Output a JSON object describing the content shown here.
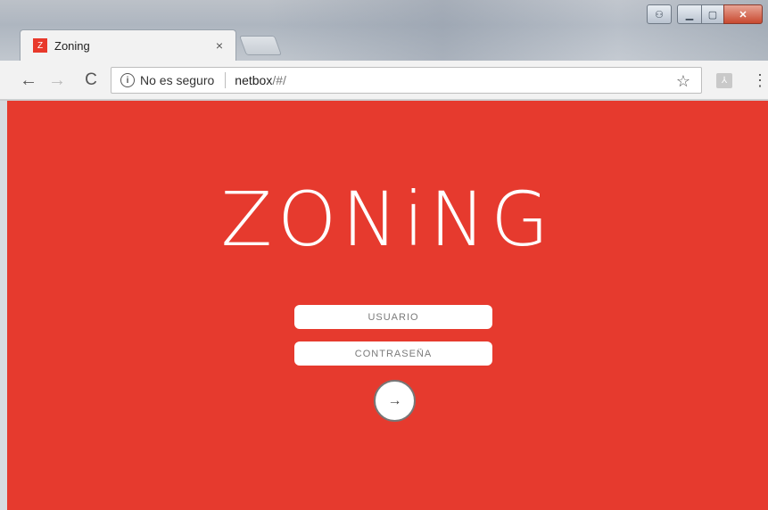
{
  "window": {
    "controls": {
      "user": "⚇",
      "minimize": "▁",
      "maximize": "▢",
      "close": "✕"
    }
  },
  "tab": {
    "favicon_letter": "Z",
    "title": "Zoning",
    "close": "×"
  },
  "toolbar": {
    "back": "←",
    "forward": "→",
    "reload": "C",
    "security_info": "i",
    "security_label": "No es seguro",
    "url_host": "netbox",
    "url_path": "/#/",
    "star": "☆",
    "ext_icon": "⅄",
    "menu": "⋮"
  },
  "page": {
    "logo": "ZONiNG",
    "username_placeholder": "USUARIO",
    "password_placeholder": "CONTRASEÑA",
    "submit_icon": "→",
    "background_color": "#e63a2e"
  }
}
